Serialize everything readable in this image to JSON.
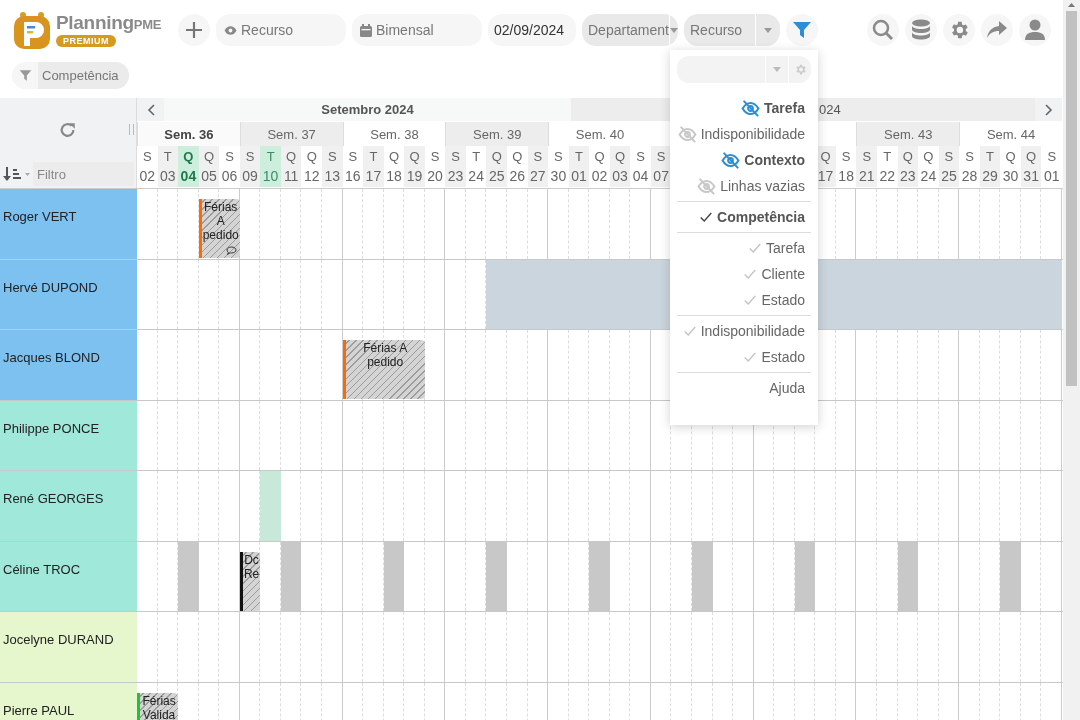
{
  "toolbar": {
    "logo": {
      "name": "Planning",
      "suffix": "PME",
      "badge": "PREMIUM"
    },
    "view_field": {
      "value": "Recurso"
    },
    "period_field": {
      "value": "Bimensal"
    },
    "date_field": {
      "value": "02/09/2024"
    },
    "department_select": {
      "value": "Departament"
    },
    "resource_select": {
      "value": "Recurso"
    },
    "filter_active": true
  },
  "filter_chips": [
    {
      "label": "Competência"
    }
  ],
  "left_panel": {
    "filter_placeholder": "Filtro"
  },
  "timeline": {
    "months": [
      {
        "label": "Setembro 2024"
      },
      {
        "label": "024"
      }
    ],
    "weeks": [
      {
        "label": "Sem. 36",
        "current": true,
        "days": [
          {
            "letter": "S",
            "number": "02",
            "today": false,
            "marked": false
          },
          {
            "letter": "T",
            "number": "03",
            "today": false,
            "marked": false
          },
          {
            "letter": "Q",
            "number": "04",
            "today": true,
            "marked": false
          },
          {
            "letter": "Q",
            "number": "05",
            "today": false,
            "marked": false
          },
          {
            "letter": "S",
            "number": "06",
            "today": false,
            "marked": false
          }
        ]
      },
      {
        "label": "Sem. 37",
        "current": false,
        "days": [
          {
            "letter": "S",
            "number": "09",
            "today": false,
            "marked": false
          },
          {
            "letter": "T",
            "number": "10",
            "today": false,
            "marked": true
          },
          {
            "letter": "Q",
            "number": "11",
            "today": false,
            "marked": false
          },
          {
            "letter": "Q",
            "number": "12",
            "today": false,
            "marked": false
          },
          {
            "letter": "S",
            "number": "13",
            "today": false,
            "marked": false
          }
        ]
      },
      {
        "label": "Sem. 38",
        "current": false,
        "days": [
          {
            "letter": "S",
            "number": "16",
            "today": false,
            "marked": false
          },
          {
            "letter": "T",
            "number": "17",
            "today": false,
            "marked": false
          },
          {
            "letter": "Q",
            "number": "18",
            "today": false,
            "marked": false
          },
          {
            "letter": "Q",
            "number": "19",
            "today": false,
            "marked": false
          },
          {
            "letter": "S",
            "number": "20",
            "today": false,
            "marked": false
          }
        ]
      },
      {
        "label": "Sem. 39",
        "current": false,
        "days": [
          {
            "letter": "S",
            "number": "23",
            "today": false,
            "marked": false
          },
          {
            "letter": "T",
            "number": "24",
            "today": false,
            "marked": false
          },
          {
            "letter": "Q",
            "number": "25",
            "today": false,
            "marked": false
          },
          {
            "letter": "Q",
            "number": "26",
            "today": false,
            "marked": false
          },
          {
            "letter": "S",
            "number": "27",
            "today": false,
            "marked": false
          }
        ]
      },
      {
        "label": "Sem. 40",
        "current": false,
        "days": [
          {
            "letter": "S",
            "number": "30",
            "today": false,
            "marked": false
          },
          {
            "letter": "T",
            "number": "01",
            "today": false,
            "marked": false
          },
          {
            "letter": "Q",
            "number": "02",
            "today": false,
            "marked": false
          },
          {
            "letter": "Q",
            "number": "03",
            "today": false,
            "marked": false
          },
          {
            "letter": "S",
            "number": "04",
            "today": false,
            "marked": false
          }
        ]
      },
      {
        "covered_at_start": false,
        "days": [
          {
            "letter": "S",
            "number": "07",
            "today": false,
            "marked": false
          }
        ]
      },
      {
        "covered_at_start": true,
        "days": [
          {
            "letter": "Q",
            "number": "17",
            "today": false,
            "marked": false
          },
          {
            "letter": "S",
            "number": "18",
            "today": false,
            "marked": false
          }
        ]
      },
      {
        "label": "Sem. 43",
        "current": false,
        "days": [
          {
            "letter": "S",
            "number": "21",
            "today": false,
            "marked": false
          },
          {
            "letter": "T",
            "number": "22",
            "today": false,
            "marked": false
          },
          {
            "letter": "Q",
            "number": "23",
            "today": false,
            "marked": false
          },
          {
            "letter": "Q",
            "number": "24",
            "today": false,
            "marked": false
          },
          {
            "letter": "S",
            "number": "25",
            "today": false,
            "marked": false
          }
        ]
      },
      {
        "label": "Sem. 44",
        "current": false,
        "days": [
          {
            "letter": "S",
            "number": "28",
            "today": false,
            "marked": false
          },
          {
            "letter": "T",
            "number": "29",
            "today": false,
            "marked": false
          },
          {
            "letter": "Q",
            "number": "30",
            "today": false,
            "marked": false
          },
          {
            "letter": "Q",
            "number": "31",
            "today": false,
            "marked": false
          },
          {
            "letter": "S",
            "number": "01",
            "today": false,
            "marked": false
          }
        ]
      }
    ]
  },
  "rows": [
    {
      "name": "Roger VERT",
      "color": "#7dc1f0",
      "cells": [
        {
          "kind": "free"
        },
        {
          "kind": "free"
        },
        {
          "kind": "free"
        },
        {
          "kind": "event",
          "label": "Férias A pedido",
          "color": "#ff6a00",
          "comment": true
        },
        {
          "kind": "more"
        }
      ]
    },
    {
      "name": "Hervé DUPOND",
      "color": "#7dc1f0",
      "cells": [
        {
          "kind": "free"
        },
        {
          "kind": "free"
        },
        {
          "kind": "free"
        },
        {
          "kind": "free"
        },
        {
          "kind": "free"
        },
        {
          "kind": "free"
        },
        {
          "kind": "free"
        },
        {
          "kind": "free"
        },
        {
          "kind": "free"
        },
        {
          "kind": "free"
        },
        {
          "kind": "free"
        },
        {
          "kind": "free"
        },
        {
          "kind": "free"
        },
        {
          "kind": "free"
        },
        {
          "kind": "free"
        },
        {
          "kind": "free"
        },
        {
          "kind": "free"
        },
        {
          "kind": "unavailable"
        },
        {
          "kind": "more"
        },
        {
          "kind": "more"
        },
        {
          "kind": "more"
        },
        {
          "kind": "more"
        },
        {
          "kind": "more"
        },
        {
          "kind": "more"
        },
        {
          "kind": "more"
        },
        {
          "kind": "more"
        },
        {
          "kind": "more"
        },
        {
          "kind": "more"
        },
        {
          "kind": "more"
        },
        {
          "kind": "more"
        },
        {
          "kind": "more"
        },
        {
          "kind": "more"
        },
        {
          "kind": "more"
        },
        {
          "kind": "more"
        },
        {
          "kind": "more"
        },
        {
          "kind": "more"
        },
        {
          "kind": "more"
        },
        {
          "kind": "more"
        },
        {
          "kind": "more"
        },
        {
          "kind": "more"
        },
        {
          "kind": "more"
        },
        {
          "kind": "more"
        },
        {
          "kind": "more"
        },
        {
          "kind": "more"
        },
        {
          "kind": "more"
        }
      ]
    },
    {
      "name": "Jacques BLOND",
      "color": "#7dc1f0",
      "cells": [
        {
          "kind": "free"
        },
        {
          "kind": "free"
        },
        {
          "kind": "free"
        },
        {
          "kind": "free"
        },
        {
          "kind": "free"
        },
        {
          "kind": "free"
        },
        {
          "kind": "free"
        },
        {
          "kind": "free"
        },
        {
          "kind": "free"
        },
        {
          "kind": "free"
        },
        {
          "kind": "event",
          "label": "Férias A pedido",
          "color": "#ff6a00",
          "comment": false
        },
        {
          "kind": "more"
        },
        {
          "kind": "more"
        },
        {
          "kind": "more"
        }
      ]
    },
    {
      "name": "Philippe PONCE",
      "color": "#a0e8d9",
      "cells": []
    },
    {
      "name": "René GEORGES",
      "color": "#a0e8d9",
      "cells": [
        {
          "kind": "free"
        },
        {
          "kind": "free"
        },
        {
          "kind": "free"
        },
        {
          "kind": "free"
        },
        {
          "kind": "free"
        },
        {
          "kind": "free"
        },
        {
          "kind": "highlight"
        }
      ]
    },
    {
      "name": "Céline TROC",
      "color": "#a0e8d9",
      "cells": [
        {
          "kind": "free"
        },
        {
          "kind": "free"
        },
        {
          "kind": "off"
        },
        {
          "kind": "free"
        },
        {
          "kind": "free"
        },
        {
          "kind": "event",
          "label": "Dc Re",
          "color": "#111111",
          "comment": false
        },
        {
          "kind": "free"
        },
        {
          "kind": "off"
        },
        {
          "kind": "free"
        },
        {
          "kind": "free"
        },
        {
          "kind": "free"
        },
        {
          "kind": "free"
        },
        {
          "kind": "off"
        },
        {
          "kind": "free"
        },
        {
          "kind": "free"
        },
        {
          "kind": "free"
        },
        {
          "kind": "free"
        },
        {
          "kind": "off"
        },
        {
          "kind": "free"
        },
        {
          "kind": "free"
        },
        {
          "kind": "free"
        },
        {
          "kind": "free"
        },
        {
          "kind": "off"
        },
        {
          "kind": "free"
        },
        {
          "kind": "free"
        },
        {
          "kind": "free"
        },
        {
          "kind": "free"
        },
        {
          "kind": "off"
        },
        {
          "kind": "free"
        },
        {
          "kind": "free"
        },
        {
          "kind": "free"
        },
        {
          "kind": "free"
        },
        {
          "kind": "off"
        },
        {
          "kind": "free"
        },
        {
          "kind": "free"
        },
        {
          "kind": "free"
        },
        {
          "kind": "free"
        },
        {
          "kind": "off"
        },
        {
          "kind": "free"
        },
        {
          "kind": "free"
        },
        {
          "kind": "free"
        },
        {
          "kind": "free"
        },
        {
          "kind": "off"
        }
      ]
    },
    {
      "name": "Jocelyne DURAND",
      "color": "#e6f6cd",
      "cells": []
    },
    {
      "name": "Pierre PAUL",
      "color": "#e6f6cd",
      "cells": [
        {
          "kind": "event",
          "label": "Férias Valida",
          "color": "#22c03c"
        },
        {
          "kind": "more"
        }
      ]
    }
  ],
  "view_menu": {
    "groups": [
      [
        {
          "kind": "visibility",
          "label": "Tarefa",
          "on": true
        },
        {
          "kind": "visibility",
          "label": "Indisponibilidade",
          "on": false
        },
        {
          "kind": "visibility",
          "label": "Contexto",
          "on": true
        },
        {
          "kind": "visibility",
          "label": "Linhas vazias",
          "on": false
        }
      ],
      [
        {
          "kind": "check",
          "label": "Competência",
          "checked": true
        }
      ],
      [
        {
          "kind": "check",
          "label": "Tarefa",
          "checked": false
        },
        {
          "kind": "check",
          "label": "Cliente",
          "checked": false
        },
        {
          "kind": "check",
          "label": "Estado",
          "checked": false
        }
      ],
      [
        {
          "kind": "check",
          "label": "Indisponibilidade",
          "checked": false
        },
        {
          "kind": "check",
          "label": "Estado",
          "checked": false
        }
      ],
      [
        {
          "kind": "link",
          "label": "Ajuda"
        }
      ]
    ]
  }
}
